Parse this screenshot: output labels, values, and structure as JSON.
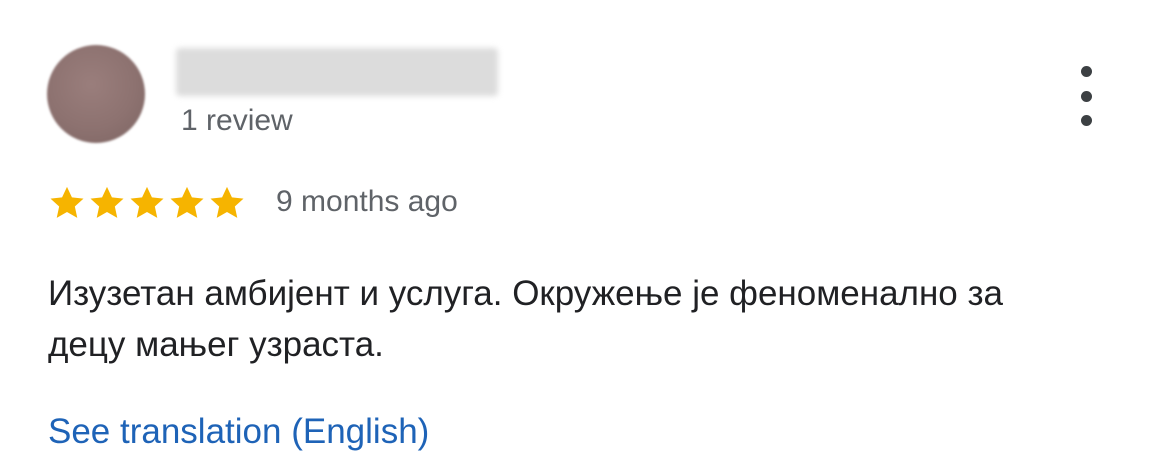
{
  "reviewer": {
    "name": "",
    "review_count": "1 review"
  },
  "menu": {
    "icon": "more-vert-icon"
  },
  "rating": {
    "stars": 5,
    "max": 5,
    "star_color": "#f6b400",
    "icon": "star-icon"
  },
  "review": {
    "time": "9 months ago",
    "text": "Изузетан амбијент и услуга. Окружење је феноменално за децу мањег узраста."
  },
  "translation": {
    "link_text": "See translation (English)",
    "link_color": "#1e63b7"
  }
}
